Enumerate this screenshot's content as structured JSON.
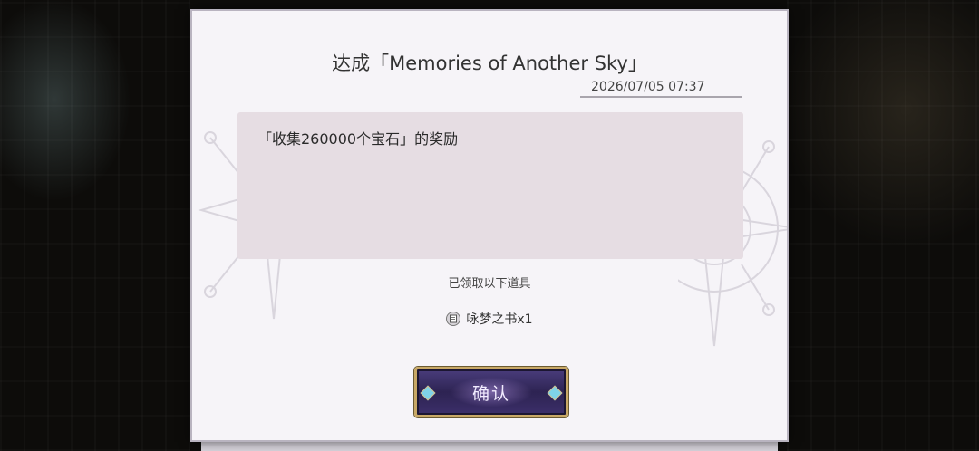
{
  "dialog": {
    "title": "达成「Memories of Another Sky」",
    "date": "2026/07/05 07:37",
    "message": "「收集260000个宝石」的奖励",
    "received_label": "已领取以下道具",
    "item": {
      "icon": "book-icon",
      "label": "咏梦之书x1"
    },
    "confirm_label": "确认"
  },
  "colors": {
    "dialog_bg": "#f6f4f8",
    "message_bg": "#e6dde3",
    "button_bg": "#2d2352",
    "button_border": "#c8a866"
  }
}
